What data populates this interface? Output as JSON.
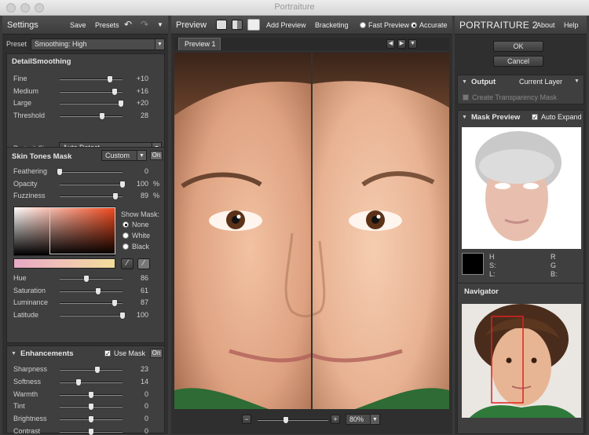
{
  "window": {
    "title": "Portraiture"
  },
  "settings": {
    "title": "Settings",
    "save": "Save",
    "presets": "Presets",
    "preset_label": "Preset",
    "preset_value": "Smoothing: High",
    "detail": {
      "title": "DetailSmoothing",
      "sliders": [
        {
          "label": "Fine",
          "value": "+10",
          "pos": 0.8
        },
        {
          "label": "Medium",
          "value": "+16",
          "pos": 0.87
        },
        {
          "label": "Large",
          "value": "+20",
          "pos": 0.97
        },
        {
          "label": "Threshold",
          "value": "28",
          "pos": 0.68
        }
      ],
      "portrait_size_label": "Portrait Size",
      "portrait_size_value": "Auto Detect"
    },
    "skin": {
      "title": "Skin Tones Mask",
      "mode": "Custom",
      "on": "On",
      "sliders": [
        {
          "label": "Feathering",
          "value": "0",
          "unit": "",
          "pos": 0.0
        },
        {
          "label": "Opacity",
          "value": "100",
          "unit": "%",
          "pos": 1.0
        },
        {
          "label": "Fuzziness",
          "value": "89",
          "unit": "%",
          "pos": 0.89
        }
      ],
      "show_mask": "Show Mask:",
      "radios": [
        "None",
        "White",
        "Black"
      ],
      "hsl": [
        {
          "label": "Hue",
          "value": "86",
          "pos": 0.43
        },
        {
          "label": "Saturation",
          "value": "61",
          "pos": 0.61
        },
        {
          "label": "Luminance",
          "value": "87",
          "pos": 0.87
        },
        {
          "label": "Latitude",
          "value": "100",
          "pos": 1.0
        }
      ]
    },
    "enh": {
      "title": "Enhancements",
      "use_mask": "Use Mask",
      "on": "On",
      "sliders": [
        {
          "label": "Sharpness",
          "value": "23",
          "pos": 0.6
        },
        {
          "label": "Softness",
          "value": "14",
          "pos": 0.3
        },
        {
          "label": "Warmth",
          "value": "0",
          "pos": 0.5
        },
        {
          "label": "Tint",
          "value": "0",
          "pos": 0.5
        },
        {
          "label": "Brightness",
          "value": "0",
          "pos": 0.5
        },
        {
          "label": "Contrast",
          "value": "0",
          "pos": 0.5
        }
      ]
    }
  },
  "preview": {
    "title": "Preview",
    "add_preview": "Add Preview",
    "bracketing": "Bracketing",
    "fast": "Fast Preview",
    "accurate": "Accurate",
    "tab": "Preview 1",
    "zoom": "80%",
    "minus": "−",
    "plus": "+"
  },
  "right": {
    "logo_a": "PORTRAITURE",
    "logo_b": "2",
    "about": "About",
    "help": "Help",
    "ok": "OK",
    "cancel": "Cancel",
    "output_title": "Output",
    "output_value": "Current Layer",
    "transparency": "Create Transparency Mask",
    "mask_title": "Mask Preview",
    "auto_expand": "Auto Expand",
    "h": "H",
    "s": "S:",
    "l": "L:",
    "r": "R",
    "g": "G",
    "b": "B:",
    "navigator": "Navigator"
  }
}
